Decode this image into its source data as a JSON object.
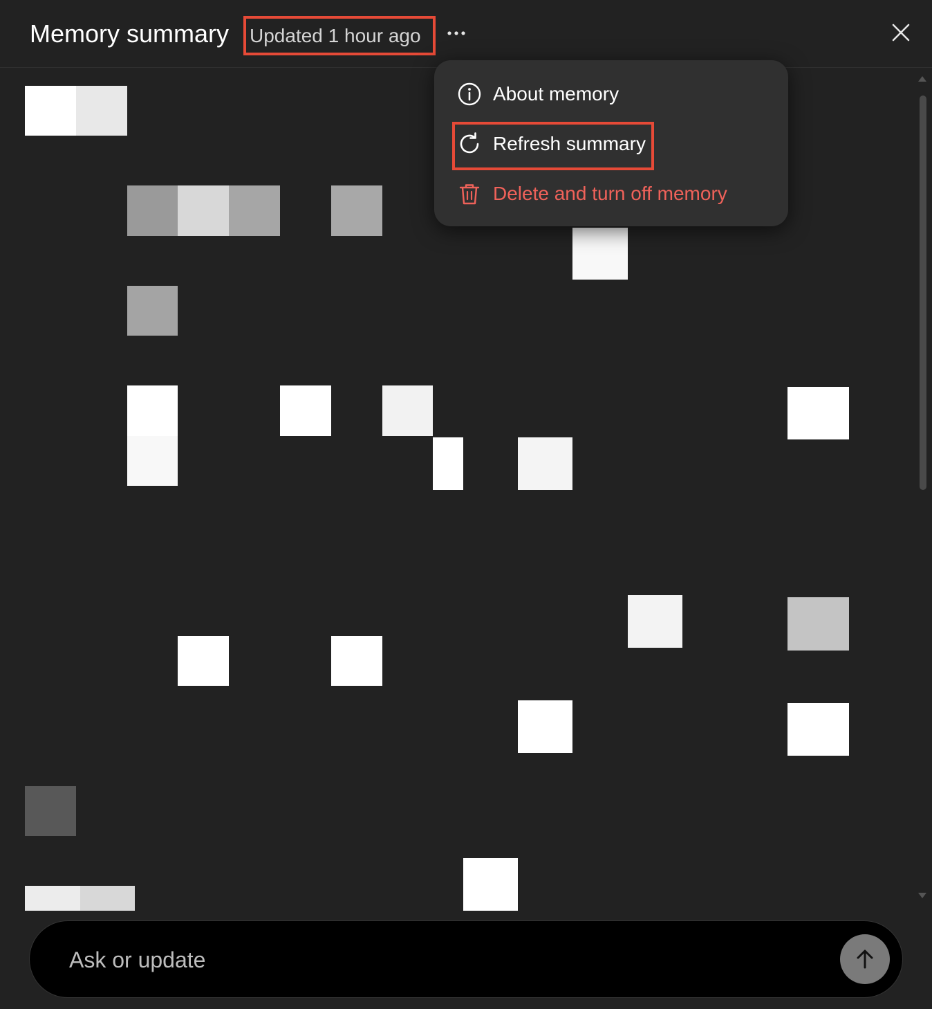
{
  "header": {
    "title": "Memory summary",
    "updated_label": "Updated 1 hour ago",
    "more_icon": "more-horizontal-icon",
    "close_icon": "close-icon"
  },
  "menu": {
    "items": [
      {
        "label": "About memory",
        "icon": "info-icon"
      },
      {
        "label": "Refresh summary",
        "icon": "refresh-icon"
      },
      {
        "label": "Delete and turn off memory",
        "icon": "trash-icon",
        "color": "#f0625a"
      }
    ]
  },
  "input": {
    "placeholder": "Ask or update",
    "value": "",
    "send_icon": "arrow-up-icon"
  },
  "colors": {
    "background": "#222222",
    "menu_background": "#303030",
    "highlight_border": "#e64a37",
    "danger_text": "#f0625a",
    "send_button": "#7a7a7a"
  }
}
